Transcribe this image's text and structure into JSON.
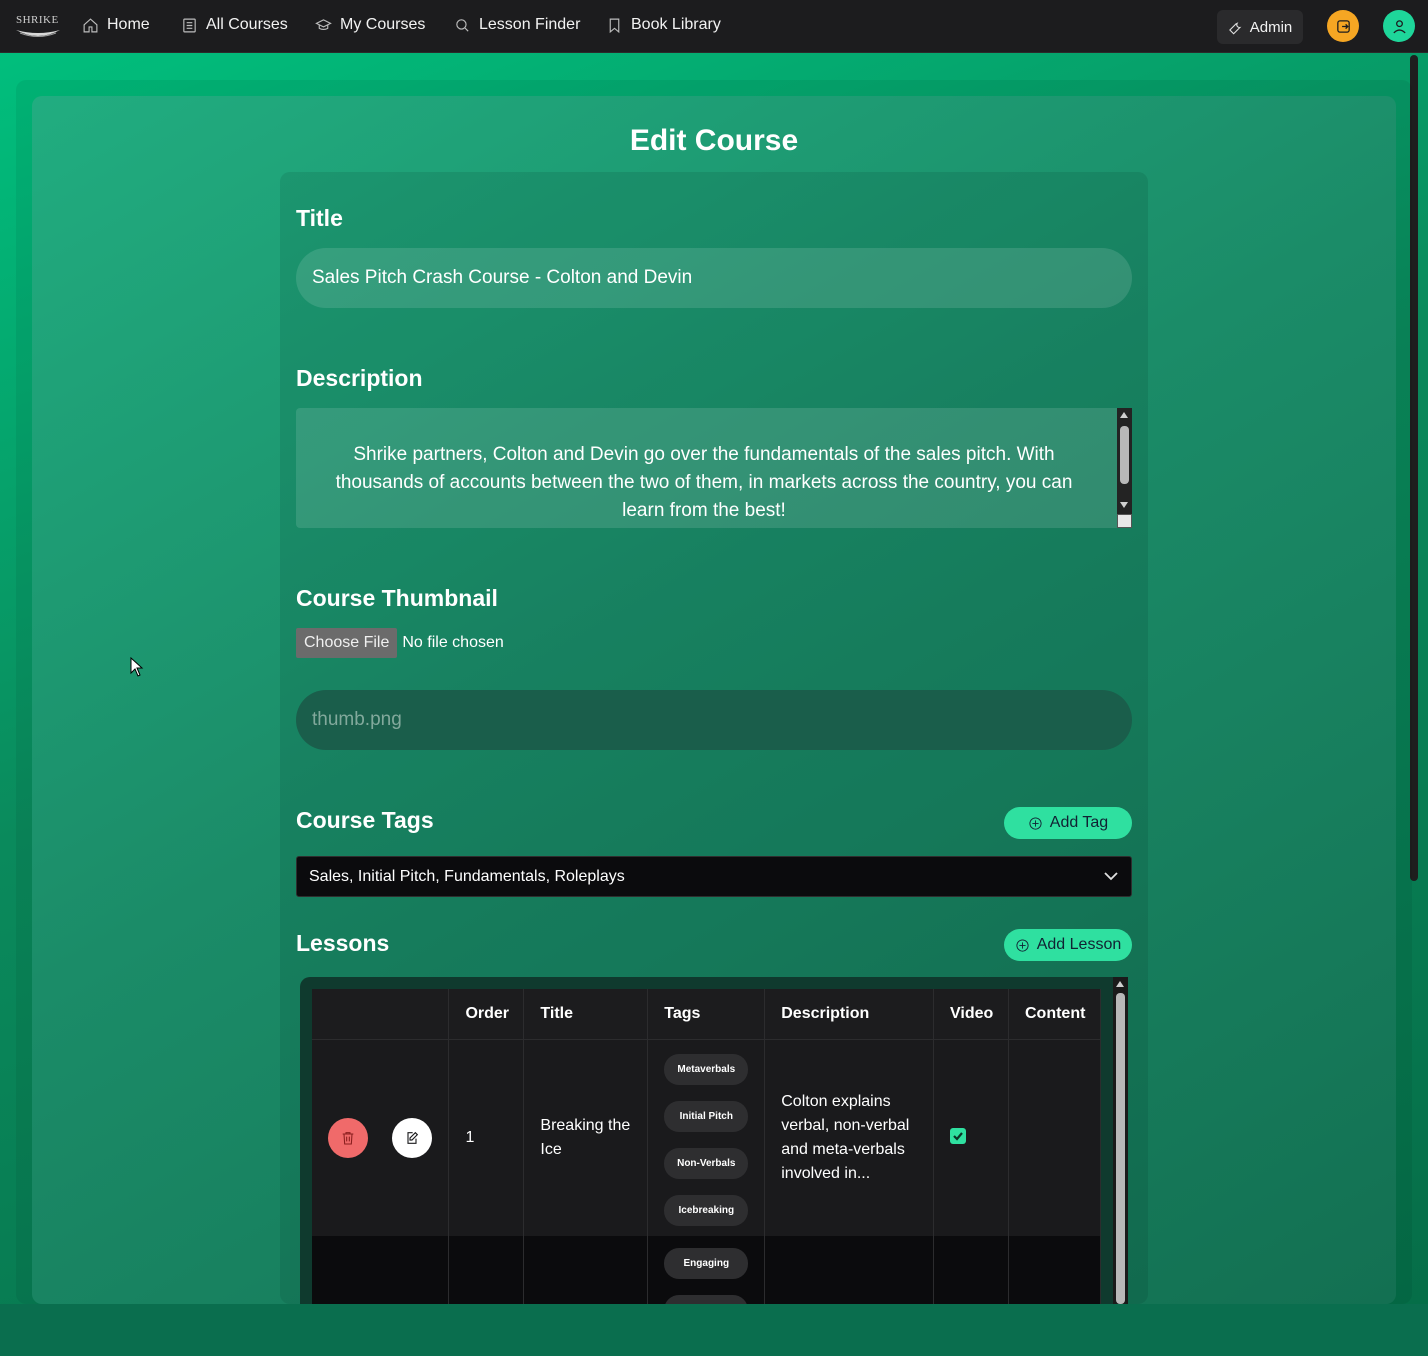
{
  "nav": {
    "logo_text": "SHRIKE",
    "items": [
      {
        "label": "Home",
        "icon": "home-icon"
      },
      {
        "label": "All Courses",
        "icon": "document-icon"
      },
      {
        "label": "My Courses",
        "icon": "graduation-cap-icon"
      },
      {
        "label": "Lesson Finder",
        "icon": "search-icon"
      },
      {
        "label": "Book Library",
        "icon": "bookmark-icon"
      }
    ],
    "admin_label": "Admin",
    "logout_color": "#f5a623",
    "profile_color": "#1ed69a"
  },
  "page": {
    "title": "Edit Course"
  },
  "form": {
    "title_label": "Title",
    "title_value": "Sales Pitch Crash Course - Colton and Devin",
    "description_label": "Description",
    "description_value": "Shrike partners, Colton and Devin go over the fundamentals of the sales pitch. With thousands of accounts between the two of them, in markets across the country, you can learn from the best!",
    "thumbnail_label": "Course Thumbnail",
    "choose_file_label": "Choose File",
    "no_file_text": "No file chosen",
    "thumbnail_placeholder": "thumb.png",
    "tags_label": "Course Tags",
    "add_tag_label": "Add Tag",
    "tags_selected": "Sales, Initial Pitch, Fundamentals, Roleplays",
    "lessons_label": "Lessons",
    "add_lesson_label": "Add Lesson"
  },
  "lessons_table": {
    "headers": [
      "",
      "Order",
      "Title",
      "Tags",
      "Description",
      "Video",
      "Content"
    ],
    "rows": [
      {
        "order": "1",
        "title": "Breaking the Ice",
        "tags": [
          "Metaverbals",
          "Initial Pitch",
          "Non-Verbals",
          "Icebreaking"
        ],
        "description": "Colton explains verbal, non-verbal and meta-verbals involved in...",
        "video": true,
        "content": ""
      },
      {
        "order": "",
        "title": "",
        "tags": [
          "Engaging",
          ""
        ],
        "description": "",
        "video": false,
        "content": ""
      }
    ]
  },
  "colors": {
    "accent": "#2fe0a0",
    "delete": "#f06a6a",
    "navbar": "#1c1c1e"
  }
}
